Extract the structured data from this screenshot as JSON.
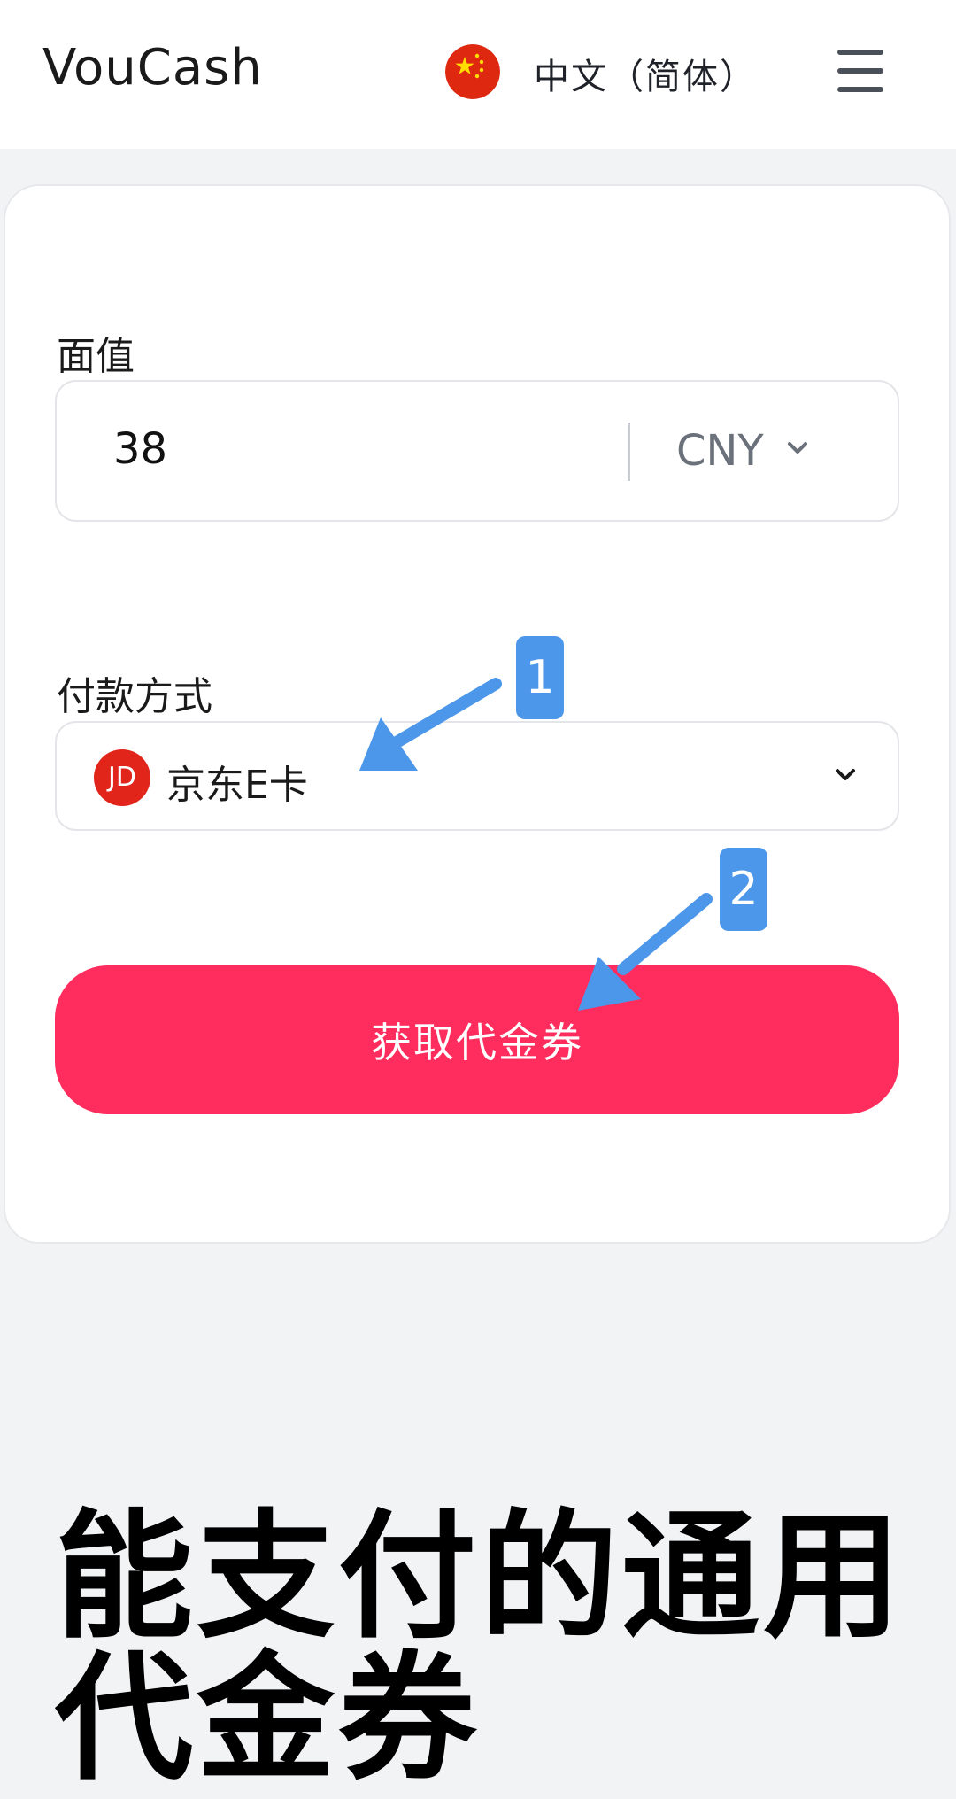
{
  "header": {
    "brand": "VouCash",
    "language": "中文（简体）",
    "flag_icon": "china-flag-icon",
    "menu_icon": "hamburger-menu-icon"
  },
  "form": {
    "amount_label": "面值",
    "amount_value": "38",
    "currency": "CNY",
    "payment_label": "付款方式",
    "payment_method": "京东E卡",
    "payment_logo_text": "JD",
    "submit_label": "获取代金券"
  },
  "hero": {
    "line1": "能支付的通用",
    "line2": "代金券"
  },
  "annotations": {
    "badge1": "1",
    "badge2": "2"
  },
  "colors": {
    "accent": "#ff2d5e",
    "annotation": "#4c97ea",
    "jd_red": "#e1251b"
  }
}
